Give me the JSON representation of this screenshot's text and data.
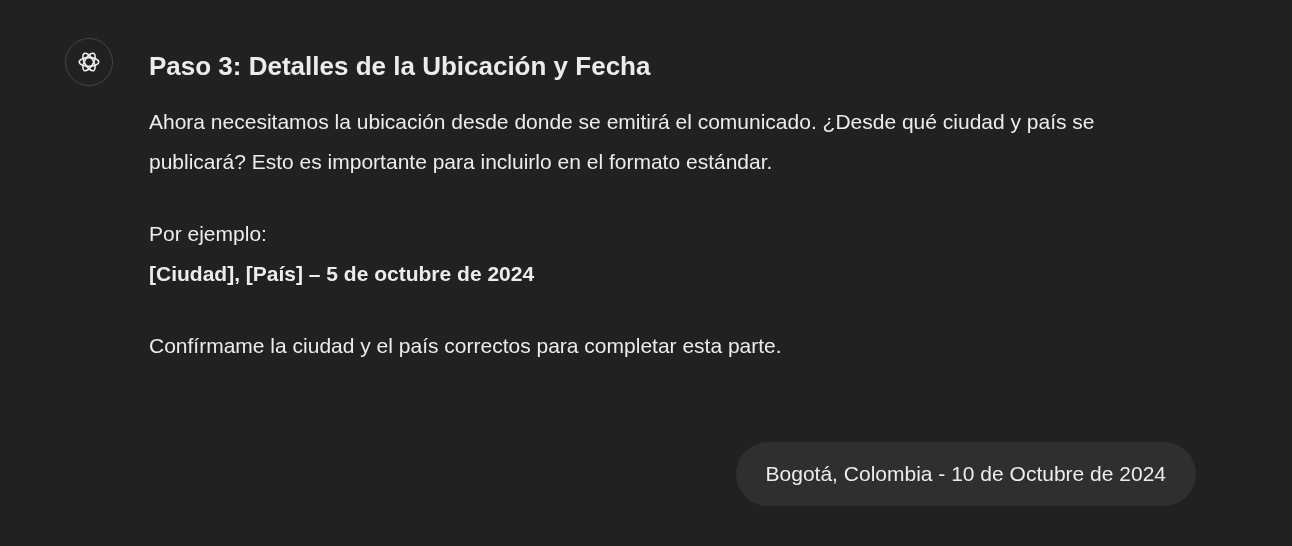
{
  "assistant_message": {
    "title": "Paso 3: Detalles de la Ubicación y Fecha",
    "intro": "Ahora necesitamos la ubicación desde donde se emitirá el comunicado. ¿Desde qué ciudad y país se publicará? Esto es importante para incluirlo en el formato estándar.",
    "example_label": "Por ejemplo:",
    "example": "[Ciudad], [País] – 5 de octubre de 2024",
    "closing": "Confírmame la ciudad y el país correctos para completar esta parte."
  },
  "user_message": "Bogotá, Colombia - 10 de Octubre de 2024"
}
